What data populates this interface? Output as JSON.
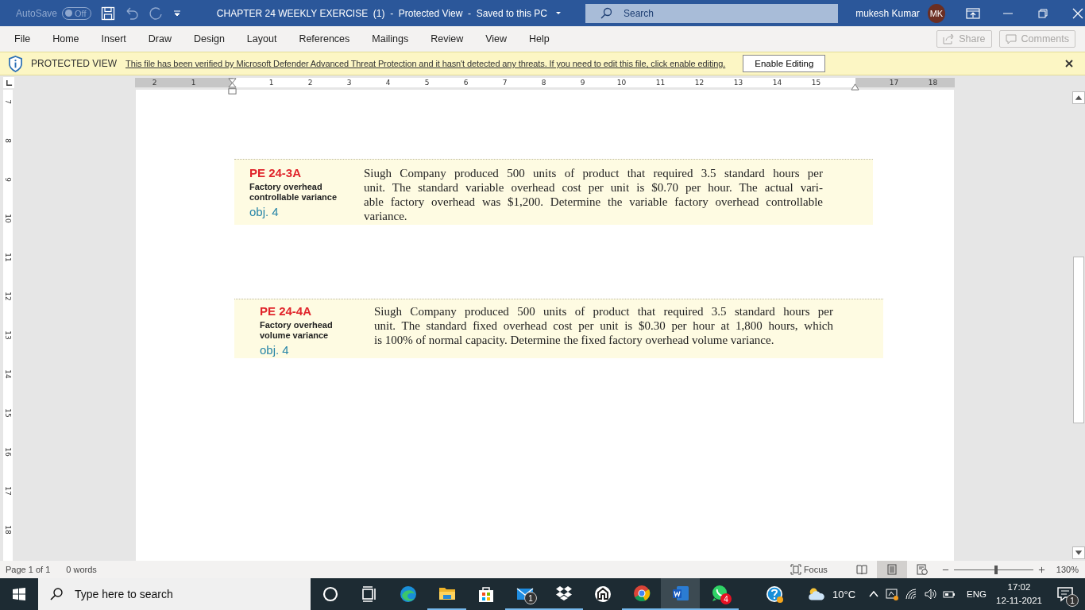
{
  "title_bar": {
    "autosave_label": "AutoSave",
    "autosave_state": "Off",
    "autosave_on": false,
    "title": "CHAPTER 24 WEEKLY EXERCISE  (1)  -  Protected View  -  Saved to this PC",
    "search_placeholder": "Search",
    "user_name": "mukesh Kumar",
    "user_initials": "MK"
  },
  "ribbon_tabs": [
    "File",
    "Home",
    "Insert",
    "Draw",
    "Design",
    "Layout",
    "References",
    "Mailings",
    "Review",
    "View",
    "Help"
  ],
  "ribbon_buttons": [
    {
      "kind": "share",
      "label": "Share",
      "disabled": true
    },
    {
      "kind": "comments",
      "label": "Comments",
      "disabled": true
    }
  ],
  "message_bar": {
    "label": "PROTECTED VIEW",
    "message": "This file has been verified by Microsoft Defender Advanced Threat Protection and it hasn't detected any threats. If you need to edit this file, click enable editing.",
    "button": "Enable Editing"
  },
  "ruler": {
    "horizontal": [
      {
        "kind": "number",
        "label": "2"
      },
      {
        "kind": "number",
        "label": "1"
      },
      {
        "kind": "first_indent"
      },
      {
        "kind": "number",
        "label": "1"
      },
      {
        "kind": "number",
        "label": "2"
      },
      {
        "kind": "number",
        "label": "3"
      },
      {
        "kind": "number",
        "label": "4"
      },
      {
        "kind": "number",
        "label": "5"
      },
      {
        "kind": "number",
        "label": "6"
      },
      {
        "kind": "number",
        "label": "7"
      },
      {
        "kind": "number",
        "label": "8"
      },
      {
        "kind": "number",
        "label": "9"
      },
      {
        "kind": "number",
        "label": "10"
      },
      {
        "kind": "number",
        "label": "11"
      },
      {
        "kind": "number",
        "label": "12"
      },
      {
        "kind": "number",
        "label": "13"
      },
      {
        "kind": "number",
        "label": "14"
      },
      {
        "kind": "number",
        "label": "15"
      },
      {
        "kind": "right_indent"
      },
      {
        "kind": "number",
        "label": "17"
      },
      {
        "kind": "number",
        "label": "18"
      }
    ],
    "vertical": [
      "7",
      "8",
      "9",
      "10",
      "11",
      "12",
      "13",
      "14",
      "15",
      "16",
      "17",
      "18"
    ]
  },
  "exercises": [
    {
      "code": "PE 24-3A",
      "topic": "Factory overhead controllable variance",
      "objective": "obj. 4",
      "lines": [
        "Siugh Company produced 500 units of product that required 3.5 standard hours per",
        "unit. The standard variable overhead cost per unit is $0.70 per hour. The actual vari-",
        "able factory overhead was $1,200. Determine the variable factory overhead controllable",
        "variance."
      ]
    },
    {
      "code": "PE 24-4A",
      "topic": "Factory overhead volume variance",
      "objective": "obj. 4",
      "lines": [
        "Siugh Company produced 500 units of product that required 3.5 standard hours per",
        "unit. The standard fixed overhead cost per unit is $0.30 per hour at 1,800 hours, which",
        "is 100% of normal capacity. Determine the fixed factory overhead volume variance."
      ]
    }
  ],
  "status_bar": {
    "page": "Page 1 of 1",
    "words": "0 words",
    "focus": "Focus",
    "views": [
      {
        "kind": "read",
        "selected": false
      },
      {
        "kind": "print",
        "selected": true
      },
      {
        "kind": "web",
        "selected": false
      }
    ],
    "zoom": {
      "level": 0.53,
      "reading": "130%"
    }
  },
  "taskbar": {
    "search_placeholder": "Type here to search",
    "apps": [
      {
        "kind": "cortana",
        "running": false,
        "selected": false
      },
      {
        "kind": "task_view",
        "running": false,
        "selected": false
      },
      {
        "kind": "edge",
        "running": false,
        "selected": false
      },
      {
        "kind": "explorer",
        "running": true,
        "selected": false
      },
      {
        "kind": "store",
        "running": false,
        "selected": false
      },
      {
        "kind": "mail",
        "running": true,
        "selected": false,
        "badge": "1"
      },
      {
        "kind": "dropbox",
        "running": true,
        "selected": false
      },
      {
        "kind": "house",
        "running": false,
        "selected": false
      },
      {
        "kind": "chrome",
        "running": true,
        "selected": false
      },
      {
        "kind": "word",
        "running": true,
        "selected": true
      },
      {
        "kind": "whatsapp",
        "running": true,
        "selected": false,
        "badge": "4"
      },
      {
        "kind": "help",
        "running": false,
        "selected": false
      }
    ],
    "weather": "10°C",
    "language": "ENG",
    "time": "17:02",
    "date": "12-11-2021",
    "notifications": "1"
  }
}
